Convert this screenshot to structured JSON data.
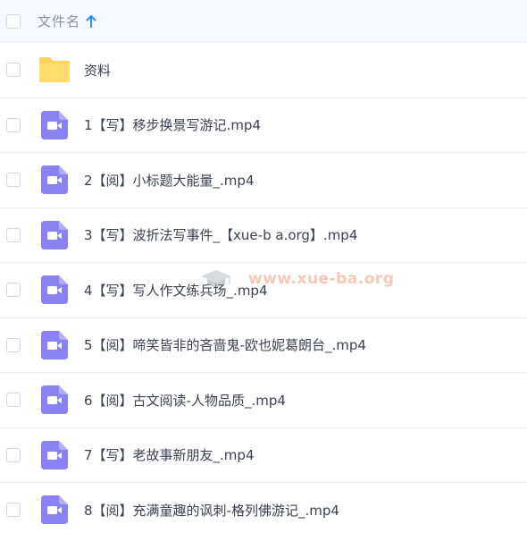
{
  "header": {
    "column_label": "文件名",
    "sort_icon": "arrow-up-icon",
    "accent": "#2f8cf0"
  },
  "colors": {
    "folder": "#ffd35b",
    "video_icon": "#8a82f2"
  },
  "files": [
    {
      "name": "资料",
      "type": "folder",
      "icon": "folder-icon"
    },
    {
      "name": "1【写】移步换景写游记.mp4",
      "type": "video",
      "icon": "video-icon"
    },
    {
      "name": "2【阅】小标题大能量_.mp4",
      "type": "video",
      "icon": "video-icon"
    },
    {
      "name": "3【写】波折法写事件_【xue-b a.org】.mp4",
      "type": "video",
      "icon": "video-icon"
    },
    {
      "name": "4【写】写人作文练兵场_.mp4",
      "type": "video",
      "icon": "video-icon"
    },
    {
      "name": "5【阅】啼笑皆非的吝啬鬼-欧也妮葛朗台_.mp4",
      "type": "video",
      "icon": "video-icon"
    },
    {
      "name": "6【阅】古文阅读-人物品质_.mp4",
      "type": "video",
      "icon": "video-icon"
    },
    {
      "name": "7【写】老故事新朋友_.mp4",
      "type": "video",
      "icon": "video-icon"
    },
    {
      "name": "8【阅】充满童趣的讽刺-格列佛游记_.mp4",
      "type": "video",
      "icon": "video-icon"
    }
  ],
  "watermark": {
    "text": "www.xue-ba.org",
    "icon": "graduation-cap-icon"
  }
}
